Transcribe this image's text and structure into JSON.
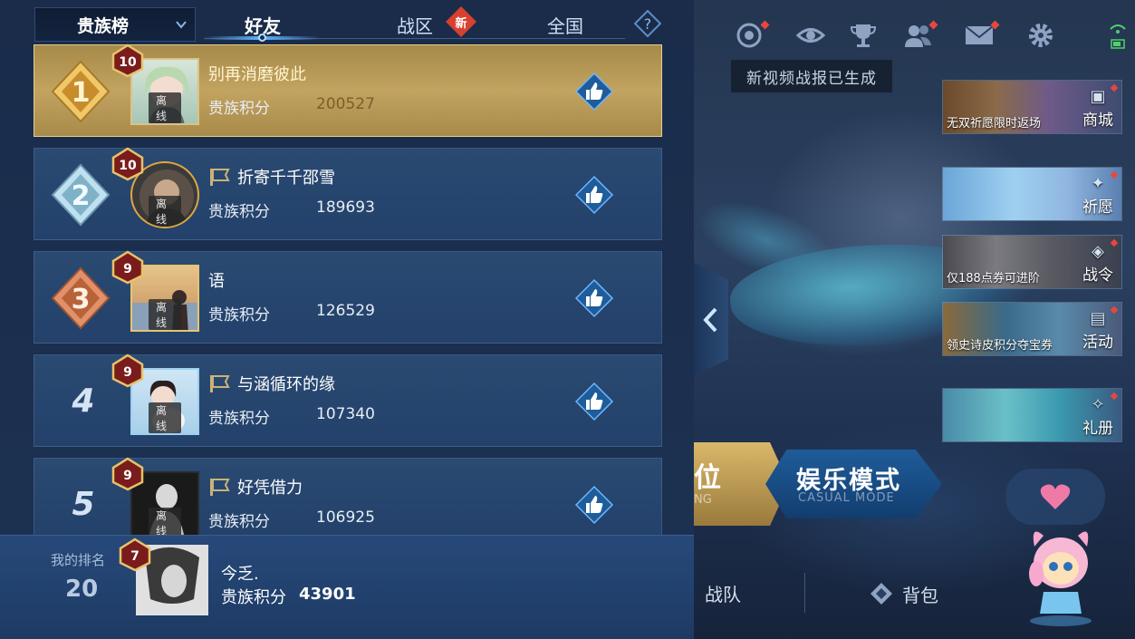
{
  "tabs": {
    "dropdown_label": "贵族榜",
    "items": [
      "好友",
      "战区",
      "全国"
    ],
    "active": "好友",
    "new_badge": "新",
    "help": "?"
  },
  "rows": [
    {
      "rank": "1",
      "tier": "10",
      "name": "别再消磨彼此",
      "status": "离线",
      "score_label": "贵族积分",
      "score": "200527"
    },
    {
      "rank": "2",
      "tier": "10",
      "name": "折寄千千邵雪",
      "status": "离线",
      "score_label": "贵族积分",
      "score": "189693"
    },
    {
      "rank": "3",
      "tier": "9",
      "name": "语",
      "status": "离线",
      "score_label": "贵族积分",
      "score": "126529"
    },
    {
      "rank": "4",
      "tier": "9",
      "name": "与涵循环的缘",
      "status": "离线",
      "score_label": "贵族积分",
      "score": "107340"
    },
    {
      "rank": "5",
      "tier": "9",
      "name": "好凭借力",
      "status": "离线",
      "score_label": "贵族积分",
      "score": "106925"
    }
  ],
  "my_rank": {
    "label": "我的排名",
    "rank": "20",
    "tier": "7",
    "name": "今乏.",
    "score_label": "贵族积分",
    "score": "43901"
  },
  "tooltip": "新视频战报已生成",
  "banners": [
    {
      "caption": "无双祈愿限时返场",
      "side": "商城"
    },
    {
      "caption": "",
      "side": "祈愿"
    },
    {
      "caption": "仅188点券可进阶",
      "side": "战令"
    },
    {
      "caption": "领史诗皮积分夺宝券",
      "side": "活动"
    },
    {
      "caption": "",
      "side": "礼册"
    }
  ],
  "modes": {
    "rank_title": "位",
    "rank_sub": "NG",
    "casual_title": "娱乐模式",
    "casual_sub": "CASUAL MODE"
  },
  "bottom_nav": {
    "team": "战队",
    "bag": "背包"
  },
  "colors": {
    "gold_row": "#c2a360",
    "row": "#2a4a72",
    "accent_blue": "#5fb6ff",
    "red_dot": "#e8463f"
  },
  "icons": [
    "record-icon",
    "eye-icon",
    "trophy-icon",
    "friends-icon",
    "mail-icon",
    "settings-icon",
    "like-icon",
    "chevron-left-icon"
  ]
}
